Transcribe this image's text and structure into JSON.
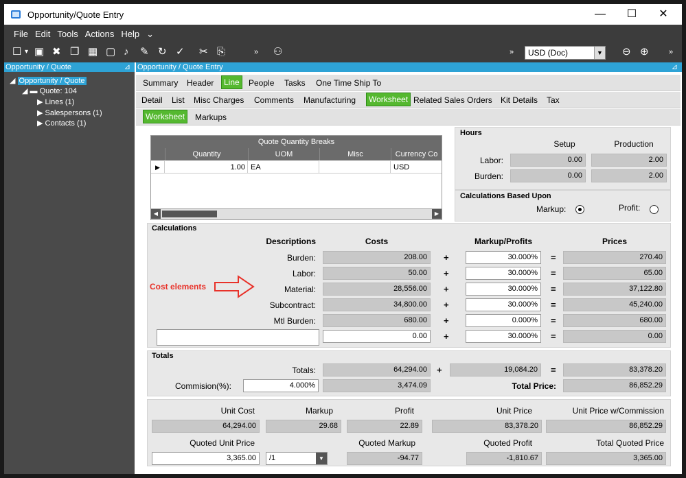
{
  "window": {
    "title": "Opportunity/Quote Entry",
    "minimize": "—",
    "maximize": "☐",
    "close": "✕"
  },
  "menu": [
    "File",
    "Edit",
    "Tools",
    "Actions",
    "Help"
  ],
  "toolbar": {
    "currency": "USD (Doc)"
  },
  "left": {
    "header": "Opportunity / Quote",
    "tree": {
      "root": "Opportunity / Quote",
      "quote": "Quote: 104",
      "lines": "Lines (1)",
      "salespersons": "Salespersons (1)",
      "contacts": "Contacts (1)"
    }
  },
  "right": {
    "header": "Opportunity / Quote Entry"
  },
  "tabs1": [
    "Summary",
    "Header",
    "Line",
    "People",
    "Tasks",
    "One Time Ship To"
  ],
  "tabs2": [
    "Detail",
    "List",
    "Misc Charges",
    "Comments",
    "Manufacturing",
    "Worksheet",
    "Related Sales Orders",
    "Kit Details",
    "Tax"
  ],
  "tabs3": [
    "Worksheet",
    "Markups"
  ],
  "qqb": {
    "title": "Quote Quantity Breaks",
    "columns": [
      "Quantity",
      "UOM",
      "Misc",
      "Currency Co"
    ],
    "row": {
      "quantity": "1.00",
      "uom": "EA",
      "misc": "",
      "currency": "USD"
    }
  },
  "hours": {
    "title": "Hours",
    "setup_label": "Setup",
    "production_label": "Production",
    "labor_label": "Labor:",
    "burden_label": "Burden:",
    "labor_setup": "0.00",
    "labor_prod": "2.00",
    "burden_setup": "0.00",
    "burden_prod": "2.00"
  },
  "calc_based": {
    "title": "Calculations Based Upon",
    "markup": "Markup:",
    "profit": "Profit:"
  },
  "calculations": {
    "title": "Calculations",
    "headers": {
      "desc": "Descriptions",
      "costs": "Costs",
      "markup": "Markup/Profits",
      "prices": "Prices"
    },
    "annotation": "Cost elements",
    "rows": [
      {
        "label": "Burden:",
        "cost": "208.00",
        "markup": "30.000%",
        "price": "270.40"
      },
      {
        "label": "Labor:",
        "cost": "50.00",
        "markup": "30.000%",
        "price": "65.00"
      },
      {
        "label": "Material:",
        "cost": "28,556.00",
        "markup": "30.000%",
        "price": "37,122.80"
      },
      {
        "label": "Subcontract:",
        "cost": "34,800.00",
        "markup": "30.000%",
        "price": "45,240.00"
      },
      {
        "label": "Mtl Burden:",
        "cost": "680.00",
        "markup": "0.000%",
        "price": "680.00"
      },
      {
        "label": "",
        "cost": "0.00",
        "markup": "30.000%",
        "price": "0.00"
      }
    ],
    "plus": "+",
    "equals": "="
  },
  "totals": {
    "title": "Totals",
    "totals_label": "Totals:",
    "cost": "64,294.00",
    "markup": "19,084.20",
    "price": "83,378.20",
    "commission_label": "Commision(%):",
    "commission_pct": "4.000%",
    "commission_amt": "3,474.09",
    "total_price_label": "Total Price:",
    "total_price": "86,852.29"
  },
  "unit": {
    "labels": [
      "Unit Cost",
      "Markup",
      "Profit",
      "Unit Price",
      "Unit Price w/Commission"
    ],
    "values": [
      "64,294.00",
      "29.68",
      "22.89",
      "83,378.20",
      "86,852.29"
    ],
    "quoted_labels": [
      "Quoted Unit Price",
      "Quoted Markup",
      "Quoted Profit",
      "Total Quoted Price"
    ],
    "quoted_unit_price": "3,365.00",
    "quoted_uom": "/1",
    "quoted_markup": "-94.77",
    "quoted_profit": "-1,810.67",
    "total_quoted_price": "3,365.00"
  }
}
